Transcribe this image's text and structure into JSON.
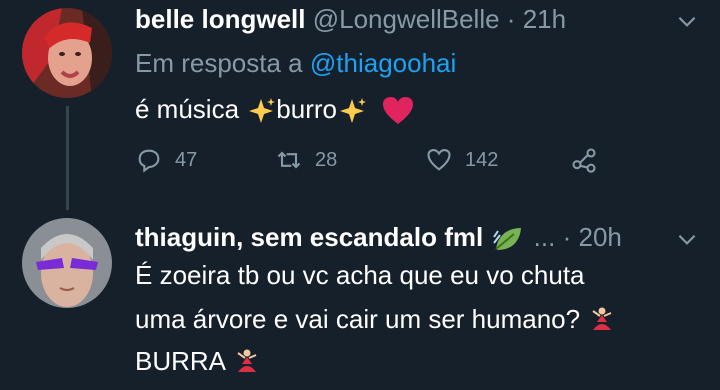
{
  "tweet1": {
    "display_name": "belle longwell",
    "handle": "@LongwellBelle",
    "time": "21h",
    "reply_prefix": "Em resposta a",
    "reply_to": "@thiagoohai",
    "text_parts": [
      "é música",
      "burro"
    ],
    "counts": {
      "replies": "47",
      "retweets": "28",
      "likes": "142"
    }
  },
  "tweet2": {
    "display_name": "thiaguin, sem escandalo fml",
    "ellipsis": "...",
    "time": "20h",
    "text_lines": [
      "É zoeira tb ou vc acha que eu vo chuta",
      "uma árvore e vai cair um ser humano?",
      "BURRA"
    ]
  },
  "separator": "·",
  "icons": {
    "reply": "speech-bubble-icon",
    "retweet": "retweet-icon",
    "like": "heart-icon",
    "share": "share-icon",
    "menu": "chevron-down-icon",
    "sparkles": "sparkles-emoji",
    "heart": "red-heart-emoji",
    "leaf": "leaf-emoji",
    "dancer": "dancer-emoji"
  },
  "colors": {
    "background": "#15202b",
    "muted": "#8899a6",
    "link": "#1da1f2",
    "red_heart": "#e0245e"
  }
}
